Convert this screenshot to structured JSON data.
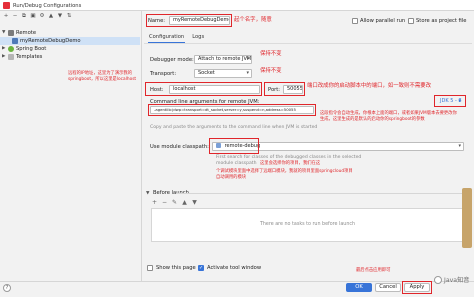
{
  "window": {
    "title": "Run/Debug Configurations"
  },
  "tree": {
    "items": [
      {
        "label": "Remote",
        "icon": "remote-icon"
      },
      {
        "label": "myRemoteDebugDemo",
        "icon": "run-config-icon"
      },
      {
        "label": "Spring Boot",
        "icon": "spring-icon"
      },
      {
        "label": "Templates",
        "icon": "templates-icon"
      }
    ]
  },
  "name": {
    "label": "Name:",
    "value": "myRemoteDebugDemo"
  },
  "options": {
    "allow_parallel": {
      "label": "Allow parallel run",
      "checked": false
    },
    "store_project": {
      "label": "Store as project file",
      "checked": false
    }
  },
  "tabs": [
    {
      "label": "Configuration",
      "active": true
    },
    {
      "label": "Logs",
      "active": false
    }
  ],
  "debugger_mode": {
    "label": "Debugger mode:",
    "value": "Attach to remote JVM"
  },
  "transport": {
    "label": "Transport:",
    "value": "Socket"
  },
  "host": {
    "label": "Host:",
    "value": "localhost"
  },
  "port": {
    "label": "Port:",
    "value": "50055"
  },
  "cmd": {
    "label": "Command line arguments for remote JVM:",
    "value": "-agentlib:jdwp=transport=dt_socket,server=y,suspend=n,address=50055",
    "jdk_label": "JDK 5 - 8",
    "hint": "Copy and paste the arguments to the command line when JVM is started"
  },
  "module": {
    "label": "Use module classpath:",
    "value": "remote-debug",
    "hint_line1": "First search for classes of the debugged classes in the selected",
    "hint_line2": "module classpath"
  },
  "before_launch": {
    "label": "Before launch",
    "empty": "There are no tasks to run before launch"
  },
  "footer": {
    "show_page": {
      "label": "Show this page",
      "checked": false
    },
    "activate_tool": {
      "label": "Activate tool window",
      "checked": true
    },
    "ok": "OK",
    "cancel": "Cancel",
    "apply": "Apply",
    "help": "?"
  },
  "annotations": {
    "name_note": "起个名字，随意",
    "keep1": "保持不变",
    "keep2": "保持不变",
    "port_note": "端口改成你的启动脚本中的端口，如一致则不需要改",
    "host_note": "远程的IP地址，这里为了演示我的springboot，所以这里是localhost",
    "jdk_note_1": "这段指令会自动生成，你根本上面的端口，或者如果JVM版本去要更改你",
    "jdk_note_2": "生成，这里生成的是默认的启动你的springboot的参数",
    "module_note_1": "这里会选择你的项目，我们在这",
    "module_note_2": "个调试模块里面中选择了远端口模块，我就的项目里面springcloud项目",
    "module_note_3": "自动调用的模块",
    "apply_note": "最后点击应用即可"
  },
  "watermark": "Java知音"
}
